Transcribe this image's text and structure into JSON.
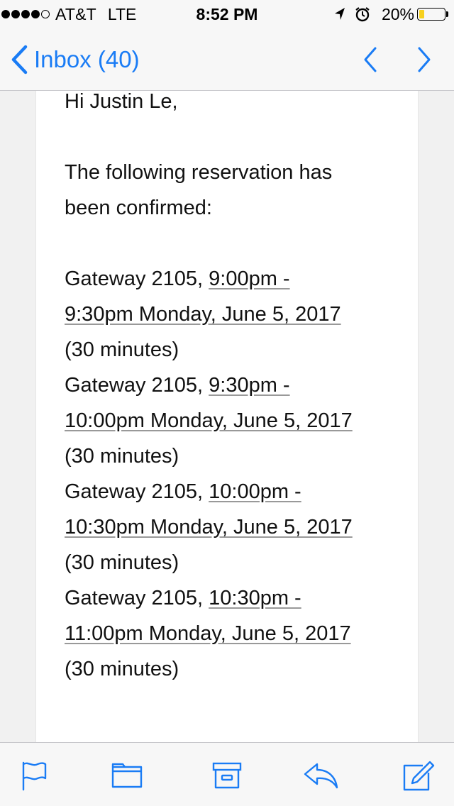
{
  "status_bar": {
    "carrier": "AT&T",
    "network": "LTE",
    "time": "8:52 PM",
    "battery": "20%",
    "battery_level": 0.2,
    "signal_bars": 4,
    "icons": [
      "location-arrow-icon",
      "alarm-clock-icon",
      "battery-icon"
    ]
  },
  "nav": {
    "back_label": "Inbox (40)",
    "prev_icon": "chevron-left-icon",
    "next_icon": "chevron-right-icon"
  },
  "email": {
    "greeting": "Hi Justin Le,",
    "intro_line1": "The following reservation has",
    "intro_line2": "been confirmed:",
    "reservations": [
      {
        "room": "Gateway 2105, ",
        "time_part1": "9:00pm -",
        "time_part2": "9:30pm Monday, June 5, 2017",
        "duration": "(30 minutes)"
      },
      {
        "room": "Gateway 2105, ",
        "time_part1": "9:30pm -",
        "time_part2": "10:00pm Monday, June 5, 2017",
        "duration": "(30 minutes)"
      },
      {
        "room": "Gateway 2105, ",
        "time_part1": "10:00pm -",
        "time_part2": "10:30pm Monday, June 5, 2017",
        "duration": "(30 minutes)"
      },
      {
        "room": "Gateway 2105, ",
        "time_part1": "10:30pm -",
        "time_part2": "11:00pm Monday, June 5, 2017",
        "duration": "(30 minutes)"
      }
    ]
  },
  "toolbar": {
    "icons": [
      "flag-icon",
      "folder-icon",
      "archive-icon",
      "reply-icon",
      "compose-icon"
    ]
  },
  "colors": {
    "accent": "#1a7cf5",
    "battery_fill": "#f7d11e",
    "bar_background": "#f7f7f7"
  }
}
